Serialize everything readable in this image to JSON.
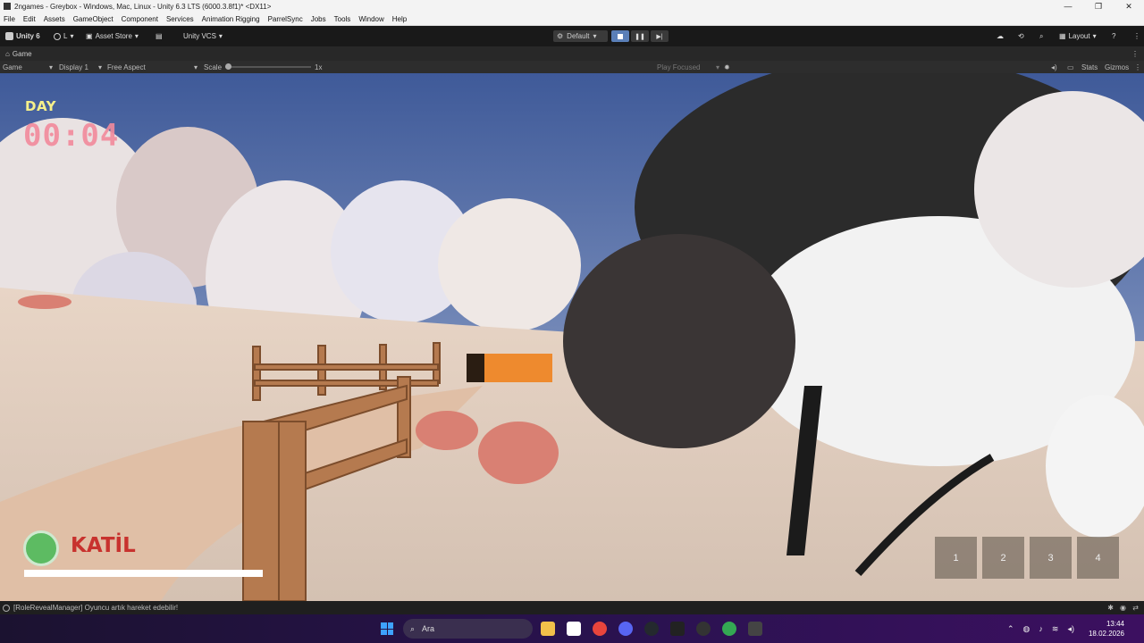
{
  "window": {
    "title": "2ngames - Greybox - Windows, Mac, Linux - Unity 6.3 LTS (6000.3.8f1)* <DX11>",
    "controls": [
      "—",
      "❐",
      "✕"
    ]
  },
  "menu": [
    "File",
    "Edit",
    "Assets",
    "GameObject",
    "Component",
    "Services",
    "Animation Rigging",
    "ParrelSync",
    "Jobs",
    "Tools",
    "Window",
    "Help"
  ],
  "toolbar": {
    "unity_label": "Unity 6",
    "account_label": "L",
    "asset_store_label": "Asset Store",
    "vcs_label": "Unity VCS",
    "build_profile": "Default",
    "layout_label": "Layout"
  },
  "tab": {
    "label": "Game"
  },
  "gamebar": {
    "mode": "Game",
    "display": "Display 1",
    "aspect": "Free Aspect",
    "scale_label": "Scale",
    "scale_value": "1x",
    "play_mode": "Play Focused",
    "stats": "Stats",
    "gizmos": "Gizmos"
  },
  "hud": {
    "phase": "DAY",
    "timer": "00:04",
    "role": "KATİL",
    "progress": 1.0
  },
  "slots": [
    "1",
    "2",
    "3",
    "4"
  ],
  "console": {
    "message": "[RoleRevealManager] Oyuncu artık hareket edebilir!"
  },
  "taskbar": {
    "search_placeholder": "Ara",
    "time": "13:44",
    "date": "18.02.2026"
  },
  "colors": {
    "day_text": "#f6f08a",
    "timer_text": "#f28a9c",
    "role_text": "#c8322e",
    "play_active": "#5a7fb8"
  }
}
